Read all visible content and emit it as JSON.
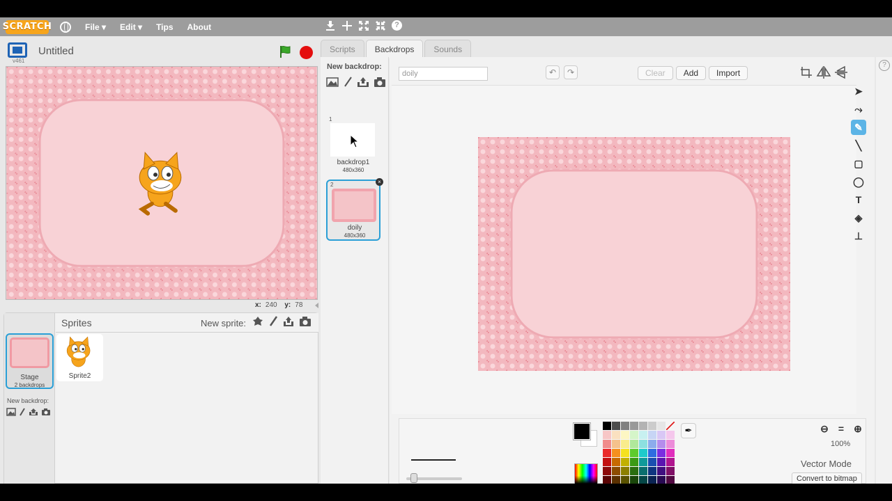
{
  "menubar": {
    "logo": "SCRATCH",
    "items": [
      "File ▾",
      "Edit ▾",
      "Tips",
      "About"
    ]
  },
  "stage": {
    "version": "v461",
    "project_title": "Untitled",
    "coords": {
      "x_label": "x:",
      "x_value": "240",
      "y_label": "y:",
      "y_value": "78"
    }
  },
  "sprites": {
    "title": "Sprites",
    "new_sprite_label": "New sprite:",
    "stage_label": "Stage",
    "stage_sub": "2 backdrops",
    "new_backdrop_label": "New backdrop:",
    "items": [
      {
        "name": "Sprite2"
      }
    ]
  },
  "tabs": [
    {
      "label": "Scripts",
      "active": false
    },
    {
      "label": "Backdrops",
      "active": true
    },
    {
      "label": "Sounds",
      "active": false
    }
  ],
  "backdrops": {
    "title": "New backdrop:",
    "items": [
      {
        "num": "1",
        "name": "backdrop1",
        "size": "480x360",
        "selected": false
      },
      {
        "num": "2",
        "name": "doily",
        "size": "480x360",
        "selected": true
      }
    ]
  },
  "editor": {
    "name_value": "doily",
    "clear_label": "Clear",
    "add_label": "Add",
    "import_label": "Import",
    "zoom_level": "100%",
    "mode_label": "Vector Mode",
    "convert_label": "Convert to bitmap",
    "palette": [
      "#000000",
      "#4d4d4d",
      "#808080",
      "#999999",
      "#b3b3b3",
      "#cccccc",
      "#e6e6e6",
      "none",
      "#f7c6c6",
      "#fae0c0",
      "#fdf6c3",
      "#d5f5c9",
      "#c7f0f0",
      "#c7d5f5",
      "#d9c7f5",
      "#f5c7ec",
      "#f08c8c",
      "#f5c28c",
      "#f9ec8c",
      "#b0e89b",
      "#8ce0e0",
      "#8cacec",
      "#b58cec",
      "#ec8cd9",
      "#ea2a2a",
      "#f5901e",
      "#f5e11e",
      "#5ecb2e",
      "#1ecbcb",
      "#2e6de0",
      "#7a2ee0",
      "#e02ebd",
      "#c21010",
      "#c76a00",
      "#c2b000",
      "#3a9a15",
      "#0f9a9a",
      "#1a4fb0",
      "#5a15b0",
      "#b0158f",
      "#8c0a0a",
      "#8c4c00",
      "#8c7f00",
      "#2a6e0f",
      "#0a6e6e",
      "#0f3580",
      "#400f80",
      "#800f67",
      "#5a0505",
      "#5a3000",
      "#5a5200",
      "#1a470a",
      "#054747",
      "#0a2352",
      "#290a52",
      "#520a42"
    ],
    "accent": "#2a9fd6"
  },
  "icons": {
    "toolbox": [
      "select-icon",
      "reshape-icon",
      "pencil-icon",
      "line-icon",
      "rectangle-icon",
      "ellipse-icon",
      "text-icon",
      "fill-icon",
      "stamp-icon"
    ]
  }
}
